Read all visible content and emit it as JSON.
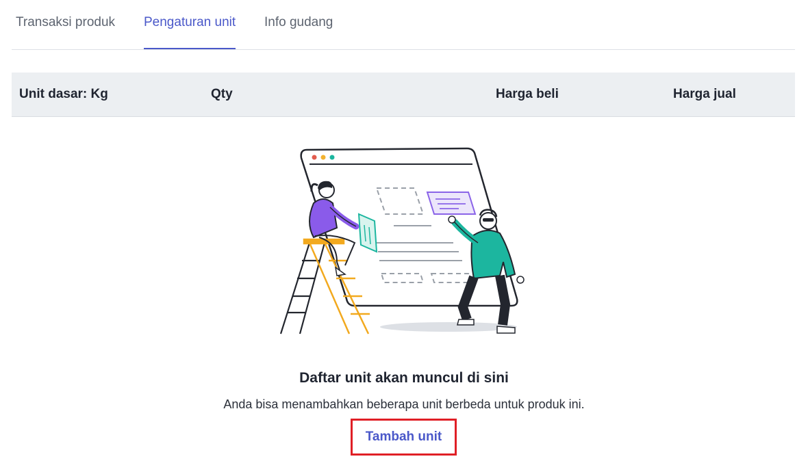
{
  "tabs": [
    {
      "label": "Transaksi produk",
      "active": false
    },
    {
      "label": "Pengaturan unit",
      "active": true
    },
    {
      "label": "Info gudang",
      "active": false
    }
  ],
  "table": {
    "headers": [
      "Unit dasar: Kg",
      "Qty",
      "Harga beli",
      "Harga jual"
    ]
  },
  "empty_state": {
    "illustration": "people-building-webpage-illustration",
    "title": "Daftar unit akan muncul di sini",
    "description": "Anda bisa menambahkan beberapa unit berbeda untuk produk ini.",
    "action_label": "Tambah unit"
  },
  "colors": {
    "accent": "#4a58c9",
    "highlight_border": "#e01f26",
    "header_bg": "#eceff2"
  }
}
